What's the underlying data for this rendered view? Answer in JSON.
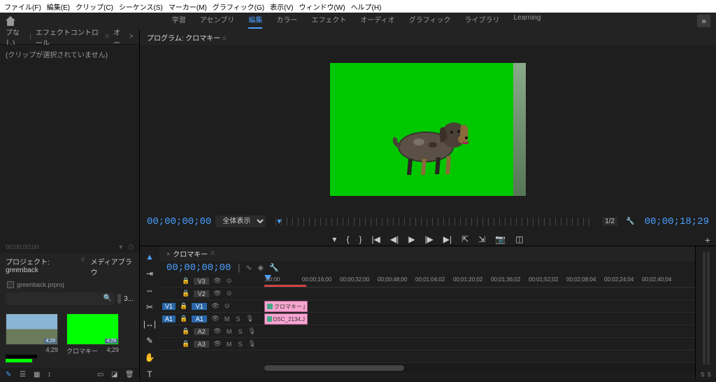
{
  "menu": [
    "ファイル(F)",
    "編集(E)",
    "クリップ(C)",
    "シーケンス(S)",
    "マーカー(M)",
    "グラフィック(G)",
    "表示(V)",
    "ウィンドウ(W)",
    "ヘルプ(H)"
  ],
  "workspaces": [
    "学習",
    "アセンブリ",
    "編集",
    "カラー",
    "エフェクト",
    "オーディオ",
    "グラフィック",
    "ライブラリ",
    "Learning"
  ],
  "workspace_active": 2,
  "effects_panel": {
    "tab_left": "プなし)",
    "tab_main": "エフェクトコントロール",
    "tab_audio_short": "オー",
    "no_clip": "(クリップが選択されていません)",
    "timestamp": "00;00;00;00"
  },
  "project_panel": {
    "tab1": "プロジェクト: greenback",
    "tab2": "メディアブラウ",
    "filename": "greenback.prproj",
    "item_count": "3...",
    "thumbs": [
      {
        "dur": "4;29",
        "name": "",
        "extra": "4;29"
      },
      {
        "dur": "4;29",
        "name": "クロマキー",
        "extra": "4;29"
      }
    ]
  },
  "program": {
    "title": "プログラム: クロマキー",
    "timecode": "00;00;00;00",
    "fit": "全体表示",
    "scale": "1/2",
    "duration": "00;00;18;29"
  },
  "timeline": {
    "seq_name": "クロマキー",
    "timecode": "00;00;00;00",
    "ruler": [
      ";00;00",
      "00;00;16;00",
      "00;00;32;00",
      "00;00;48;00",
      "00;01;04;02",
      "00;01;20;02",
      "00;01;36;02",
      "00;01;52;02",
      "00;02;08;04",
      "00;02;24;04",
      "00;02;40;04"
    ],
    "video_tracks": [
      "V3",
      "V2",
      "V1"
    ],
    "audio_tracks": [
      "A1",
      "A2",
      "A3"
    ],
    "clips": [
      {
        "track": 1,
        "label": "クロマキー.j"
      },
      {
        "track": 2,
        "label": "DSC_2134.J"
      }
    ]
  },
  "meters": {
    "l": "S",
    "r": "S"
  }
}
